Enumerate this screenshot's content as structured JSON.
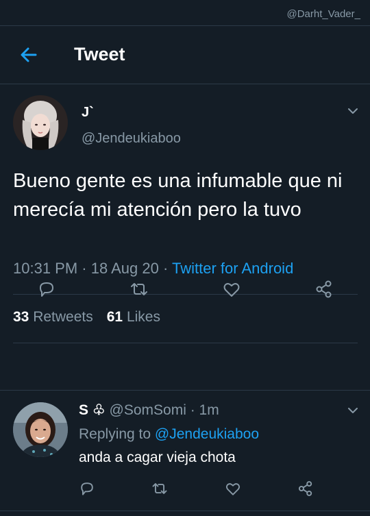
{
  "watermark": "@Darht_Vader_",
  "header": {
    "title": "Tweet"
  },
  "tweet": {
    "display_name": "J`",
    "handle": "@Jendeukiaboo",
    "text": "Bueno gente es una infumable que ni merecía mi atención pero la tuvo",
    "time": "10:31 PM",
    "sep1": " · ",
    "date": "18 Aug 20",
    "sep2": " · ",
    "source": "Twitter for Android",
    "retweets_count": "33",
    "retweets_label": "Retweets",
    "likes_count": "61",
    "likes_label": "Likes"
  },
  "reply": {
    "display_name": "S ♧",
    "handle": "@SomSomi",
    "sep": " · ",
    "time": "1m",
    "replying_to_label": "Replying to",
    "replying_to_handle": "@Jendeukiaboo",
    "text": "anda a cagar vieja chota"
  },
  "icons": {
    "back": "back-arrow-icon",
    "chevron": "chevron-down-icon",
    "reply": "reply-icon",
    "retweet": "retweet-icon",
    "like": "heart-icon",
    "share": "share-icon"
  },
  "colors": {
    "background": "#141d26",
    "accent": "#1da1f2",
    "secondary_text": "#8899a6",
    "divider": "#2c3a48"
  }
}
